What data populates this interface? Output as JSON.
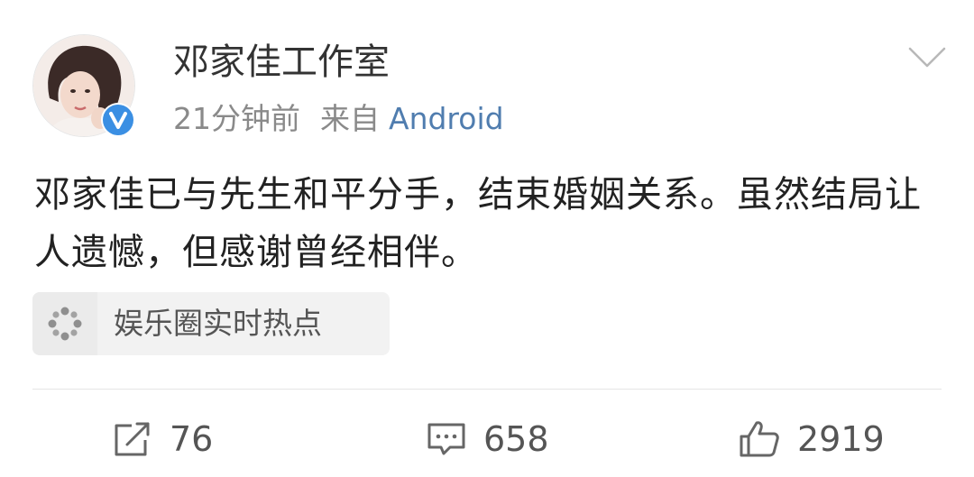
{
  "author": {
    "name": "邓家佳工作室",
    "verified": true
  },
  "meta": {
    "time": "21分钟前",
    "source_prefix": "来自",
    "source": "Android"
  },
  "post": {
    "text": "邓家佳已与先生和平分手，结束婚姻关系。虽然结局让人遗憾，但感谢曾经相伴。"
  },
  "topic": {
    "label": "娱乐圈实时热点",
    "icon": "sparkle-icon"
  },
  "actions": {
    "repost_count": "76",
    "comment_count": "658",
    "like_count": "2919"
  },
  "colors": {
    "link": "#507daf",
    "verified_badge": "#3b8fe3",
    "text_primary": "#222222",
    "text_secondary": "#8a8a8a"
  }
}
